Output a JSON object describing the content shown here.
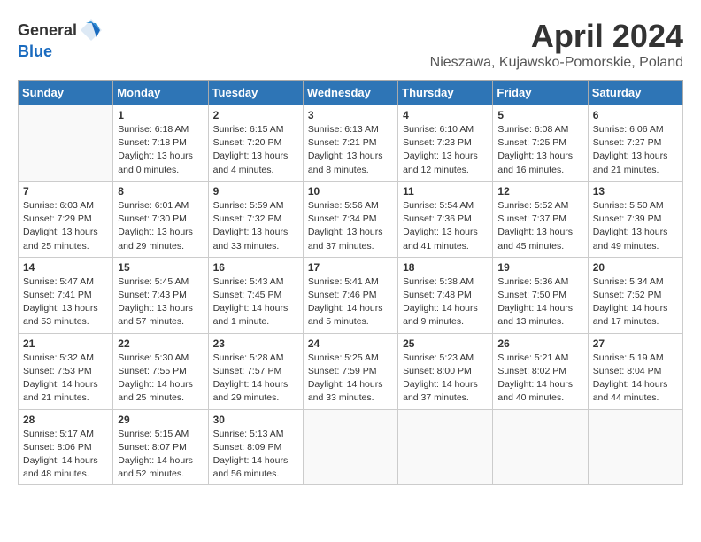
{
  "header": {
    "logo_general": "General",
    "logo_blue": "Blue",
    "title": "April 2024",
    "subtitle": "Nieszawa, Kujawsko-Pomorskie, Poland"
  },
  "days_of_week": [
    "Sunday",
    "Monday",
    "Tuesday",
    "Wednesday",
    "Thursday",
    "Friday",
    "Saturday"
  ],
  "weeks": [
    [
      {
        "day": "",
        "sunrise": "",
        "sunset": "",
        "daylight": "",
        "empty": true
      },
      {
        "day": "1",
        "sunrise": "Sunrise: 6:18 AM",
        "sunset": "Sunset: 7:18 PM",
        "daylight": "Daylight: 13 hours and 0 minutes."
      },
      {
        "day": "2",
        "sunrise": "Sunrise: 6:15 AM",
        "sunset": "Sunset: 7:20 PM",
        "daylight": "Daylight: 13 hours and 4 minutes."
      },
      {
        "day": "3",
        "sunrise": "Sunrise: 6:13 AM",
        "sunset": "Sunset: 7:21 PM",
        "daylight": "Daylight: 13 hours and 8 minutes."
      },
      {
        "day": "4",
        "sunrise": "Sunrise: 6:10 AM",
        "sunset": "Sunset: 7:23 PM",
        "daylight": "Daylight: 13 hours and 12 minutes."
      },
      {
        "day": "5",
        "sunrise": "Sunrise: 6:08 AM",
        "sunset": "Sunset: 7:25 PM",
        "daylight": "Daylight: 13 hours and 16 minutes."
      },
      {
        "day": "6",
        "sunrise": "Sunrise: 6:06 AM",
        "sunset": "Sunset: 7:27 PM",
        "daylight": "Daylight: 13 hours and 21 minutes."
      }
    ],
    [
      {
        "day": "7",
        "sunrise": "Sunrise: 6:03 AM",
        "sunset": "Sunset: 7:29 PM",
        "daylight": "Daylight: 13 hours and 25 minutes."
      },
      {
        "day": "8",
        "sunrise": "Sunrise: 6:01 AM",
        "sunset": "Sunset: 7:30 PM",
        "daylight": "Daylight: 13 hours and 29 minutes."
      },
      {
        "day": "9",
        "sunrise": "Sunrise: 5:59 AM",
        "sunset": "Sunset: 7:32 PM",
        "daylight": "Daylight: 13 hours and 33 minutes."
      },
      {
        "day": "10",
        "sunrise": "Sunrise: 5:56 AM",
        "sunset": "Sunset: 7:34 PM",
        "daylight": "Daylight: 13 hours and 37 minutes."
      },
      {
        "day": "11",
        "sunrise": "Sunrise: 5:54 AM",
        "sunset": "Sunset: 7:36 PM",
        "daylight": "Daylight: 13 hours and 41 minutes."
      },
      {
        "day": "12",
        "sunrise": "Sunrise: 5:52 AM",
        "sunset": "Sunset: 7:37 PM",
        "daylight": "Daylight: 13 hours and 45 minutes."
      },
      {
        "day": "13",
        "sunrise": "Sunrise: 5:50 AM",
        "sunset": "Sunset: 7:39 PM",
        "daylight": "Daylight: 13 hours and 49 minutes."
      }
    ],
    [
      {
        "day": "14",
        "sunrise": "Sunrise: 5:47 AM",
        "sunset": "Sunset: 7:41 PM",
        "daylight": "Daylight: 13 hours and 53 minutes."
      },
      {
        "day": "15",
        "sunrise": "Sunrise: 5:45 AM",
        "sunset": "Sunset: 7:43 PM",
        "daylight": "Daylight: 13 hours and 57 minutes."
      },
      {
        "day": "16",
        "sunrise": "Sunrise: 5:43 AM",
        "sunset": "Sunset: 7:45 PM",
        "daylight": "Daylight: 14 hours and 1 minute."
      },
      {
        "day": "17",
        "sunrise": "Sunrise: 5:41 AM",
        "sunset": "Sunset: 7:46 PM",
        "daylight": "Daylight: 14 hours and 5 minutes."
      },
      {
        "day": "18",
        "sunrise": "Sunrise: 5:38 AM",
        "sunset": "Sunset: 7:48 PM",
        "daylight": "Daylight: 14 hours and 9 minutes."
      },
      {
        "day": "19",
        "sunrise": "Sunrise: 5:36 AM",
        "sunset": "Sunset: 7:50 PM",
        "daylight": "Daylight: 14 hours and 13 minutes."
      },
      {
        "day": "20",
        "sunrise": "Sunrise: 5:34 AM",
        "sunset": "Sunset: 7:52 PM",
        "daylight": "Daylight: 14 hours and 17 minutes."
      }
    ],
    [
      {
        "day": "21",
        "sunrise": "Sunrise: 5:32 AM",
        "sunset": "Sunset: 7:53 PM",
        "daylight": "Daylight: 14 hours and 21 minutes."
      },
      {
        "day": "22",
        "sunrise": "Sunrise: 5:30 AM",
        "sunset": "Sunset: 7:55 PM",
        "daylight": "Daylight: 14 hours and 25 minutes."
      },
      {
        "day": "23",
        "sunrise": "Sunrise: 5:28 AM",
        "sunset": "Sunset: 7:57 PM",
        "daylight": "Daylight: 14 hours and 29 minutes."
      },
      {
        "day": "24",
        "sunrise": "Sunrise: 5:25 AM",
        "sunset": "Sunset: 7:59 PM",
        "daylight": "Daylight: 14 hours and 33 minutes."
      },
      {
        "day": "25",
        "sunrise": "Sunrise: 5:23 AM",
        "sunset": "Sunset: 8:00 PM",
        "daylight": "Daylight: 14 hours and 37 minutes."
      },
      {
        "day": "26",
        "sunrise": "Sunrise: 5:21 AM",
        "sunset": "Sunset: 8:02 PM",
        "daylight": "Daylight: 14 hours and 40 minutes."
      },
      {
        "day": "27",
        "sunrise": "Sunrise: 5:19 AM",
        "sunset": "Sunset: 8:04 PM",
        "daylight": "Daylight: 14 hours and 44 minutes."
      }
    ],
    [
      {
        "day": "28",
        "sunrise": "Sunrise: 5:17 AM",
        "sunset": "Sunset: 8:06 PM",
        "daylight": "Daylight: 14 hours and 48 minutes."
      },
      {
        "day": "29",
        "sunrise": "Sunrise: 5:15 AM",
        "sunset": "Sunset: 8:07 PM",
        "daylight": "Daylight: 14 hours and 52 minutes."
      },
      {
        "day": "30",
        "sunrise": "Sunrise: 5:13 AM",
        "sunset": "Sunset: 8:09 PM",
        "daylight": "Daylight: 14 hours and 56 minutes."
      },
      {
        "day": "",
        "sunrise": "",
        "sunset": "",
        "daylight": "",
        "empty": true
      },
      {
        "day": "",
        "sunrise": "",
        "sunset": "",
        "daylight": "",
        "empty": true
      },
      {
        "day": "",
        "sunrise": "",
        "sunset": "",
        "daylight": "",
        "empty": true
      },
      {
        "day": "",
        "sunrise": "",
        "sunset": "",
        "daylight": "",
        "empty": true
      }
    ]
  ]
}
